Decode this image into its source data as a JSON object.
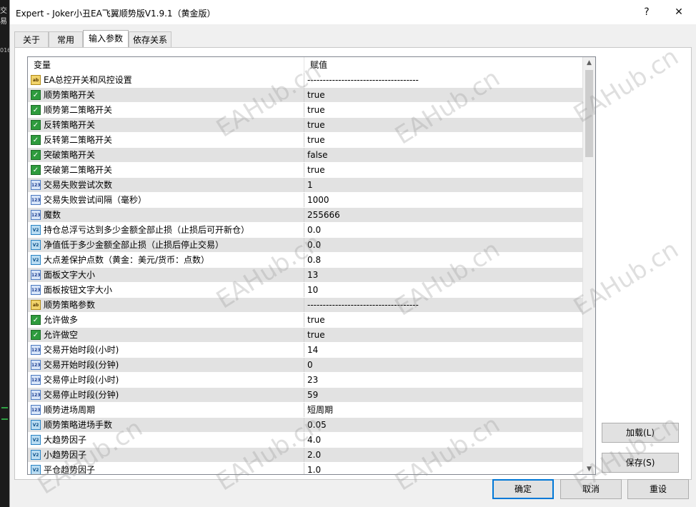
{
  "window": {
    "title": "Expert - Joker小丑EA飞翼顺势版V1.9.1（黄金版）",
    "help": "?",
    "close": "✕"
  },
  "left_strip": {
    "text": "交易",
    "text2": "016"
  },
  "tabs": [
    {
      "label": "关于",
      "active": false
    },
    {
      "label": "常用",
      "active": false
    },
    {
      "label": "输入参数",
      "active": true
    },
    {
      "label": "依存关系",
      "active": false
    }
  ],
  "grid": {
    "headers": [
      "变量",
      "赋值"
    ],
    "rows": [
      {
        "type": "str",
        "icon": "ab",
        "name": "EA总控开关和风控设置",
        "value": "------------------------------------"
      },
      {
        "type": "bool",
        "icon": "bool",
        "name": "顺势策略开关",
        "value": "true"
      },
      {
        "type": "bool",
        "icon": "bool",
        "name": "顺势第二策略开关",
        "value": "true"
      },
      {
        "type": "bool",
        "icon": "bool",
        "name": "反转策略开关",
        "value": "true"
      },
      {
        "type": "bool",
        "icon": "bool",
        "name": "反转第二策略开关",
        "value": "true"
      },
      {
        "type": "bool",
        "icon": "bool",
        "name": "突破策略开关",
        "value": "false"
      },
      {
        "type": "bool",
        "icon": "bool",
        "name": "突破第二策略开关",
        "value": "true"
      },
      {
        "type": "int",
        "icon": "123",
        "name": "交易失败尝试次数",
        "value": "1"
      },
      {
        "type": "int",
        "icon": "123",
        "name": "交易失败尝试间隔（毫秒）",
        "value": "1000"
      },
      {
        "type": "int",
        "icon": "123",
        "name": "魔数",
        "value": "255666"
      },
      {
        "type": "dbl",
        "icon": "V2",
        "name": "持仓总浮亏达到多少金额全部止损（止损后可开新仓）",
        "value": "0.0"
      },
      {
        "type": "dbl",
        "icon": "V2",
        "name": "净值低于多少金额全部止损（止损后停止交易）",
        "value": "0.0"
      },
      {
        "type": "dbl",
        "icon": "V2",
        "name": "大点差保护点数（黄金：美元/货币：点数）",
        "value": "0.8"
      },
      {
        "type": "int",
        "icon": "123",
        "name": "面板文字大小",
        "value": "13"
      },
      {
        "type": "int",
        "icon": "123",
        "name": "面板按钮文字大小",
        "value": "10"
      },
      {
        "type": "str",
        "icon": "ab",
        "name": "顺势策略参数",
        "value": "------------------------------------"
      },
      {
        "type": "bool",
        "icon": "bool",
        "name": "允许做多",
        "value": "true"
      },
      {
        "type": "bool",
        "icon": "bool",
        "name": "允许做空",
        "value": "true"
      },
      {
        "type": "int",
        "icon": "123",
        "name": "交易开始时段(小时)",
        "value": "14"
      },
      {
        "type": "int",
        "icon": "123",
        "name": "交易开始时段(分钟)",
        "value": "0"
      },
      {
        "type": "int",
        "icon": "123",
        "name": "交易停止时段(小时)",
        "value": "23"
      },
      {
        "type": "int",
        "icon": "123",
        "name": "交易停止时段(分钟)",
        "value": "59"
      },
      {
        "type": "int",
        "icon": "123",
        "name": "顺势进场周期",
        "value": "短周期"
      },
      {
        "type": "dbl",
        "icon": "V2",
        "name": "顺势策略进场手数",
        "value": "0.05"
      },
      {
        "type": "dbl",
        "icon": "V2",
        "name": "大趋势因子",
        "value": "4.0"
      },
      {
        "type": "dbl",
        "icon": "V2",
        "name": "小趋势因子",
        "value": "2.0"
      },
      {
        "type": "dbl",
        "icon": "V2",
        "name": "平仓趋势因子",
        "value": "1.0"
      }
    ]
  },
  "buttons": {
    "load": "加载(L)",
    "save": "保存(S)",
    "ok": "确定",
    "cancel": "取消",
    "reset": "重设"
  },
  "watermark": "EAHub.cn"
}
